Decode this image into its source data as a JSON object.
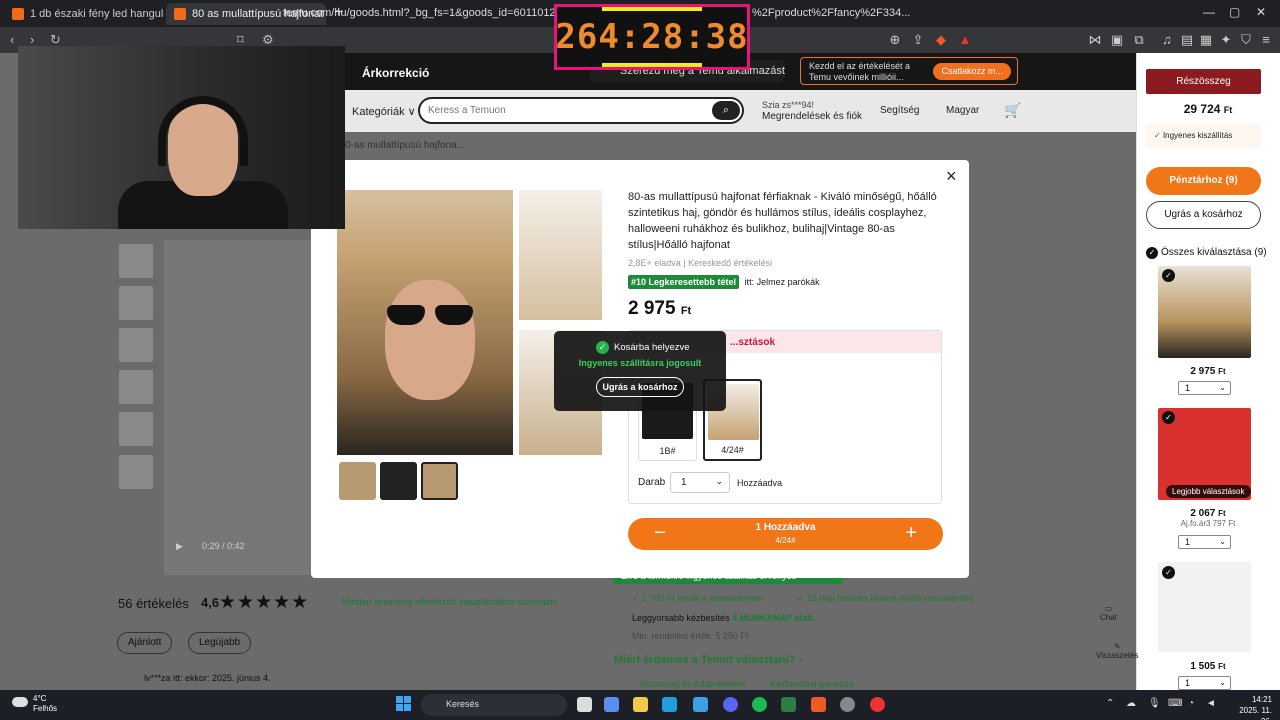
{
  "browser": {
    "tabs": [
      {
        "label": "1 db északi fény led hangulatvetítő lá"
      },
      {
        "label": "80 as mullattípusú hajfonat férfia"
      }
    ],
    "new_tab": "+",
    "url": "temu.com/hu/goods.html?_bg_fs=1&goods_id=601101252687626",
    "url_tail": "%2Fproduct%2Ffancy%2F334..."
  },
  "timer": {
    "value": "264:28:38"
  },
  "temu_header": {
    "arkorrekcio": "Árkorrekció",
    "promo": "Szerezd meg a Temu alkalmazást",
    "review_promo_line1": "Kezdd el az értékelését a",
    "review_promo_line2": "Temu vevőinek millióii...",
    "review_promo_btn": "Csatlakozz m..."
  },
  "search": {
    "categories": "Kategóriák ∨",
    "placeholder": "Keress a Temuon",
    "account_line1": "Szia zs***94!",
    "account_line2": "Megrendelések és fiók",
    "help": "Segítség",
    "lang": "Magyar"
  },
  "breadcrumb": "0-as mullattípusú hajfona...",
  "modal": {
    "title": "80-as mullattípusú hajfonat férfiaknak - Kiváló minőségű, hőálló szintetikus haj, göndör és hullámos stílus, ideális cosplayhez, halloweeni ruhákhoz és bulikhoz, bulihaj|Vintage 80-as stílus|Hőálló hajfonat",
    "sold": "2,8E+ eladva",
    "merchant_rating": "Kereskedő értékelési",
    "rank_badge": "#10 Legkeresettebb tétel",
    "rank_text": "itt: Jelmez parókák",
    "price": "2 975",
    "currency": "Ft",
    "options_header": "...sztások",
    "variants": [
      {
        "label": "1B#"
      },
      {
        "label": "4/24#"
      }
    ],
    "qty_label": "Darab",
    "qty_value": "1",
    "added_label": "Hozzáadva",
    "add_button": "1 Hozzáadva",
    "add_sub": "4/24#",
    "minus": "−",
    "plus": "+",
    "close": "×"
  },
  "toast": {
    "title": "Kosárba helyezve",
    "shipping": "Ingyenes szállításra jogosult",
    "button": "Ugrás a kosárhoz"
  },
  "reviews": {
    "count_label": "56 értékelés",
    "rating": "4,6",
    "stars": "★★★★★",
    "verified": "Minden vélemény ellenőrzött vásárlásokból származik",
    "sort_recommended": "Ajánlott",
    "sort_latest": "Legújabb",
    "reviewer": "lv***za itt:  ekkor: 2025. június 4."
  },
  "video": {
    "time": "0:29 / 0:42"
  },
  "shipping_info": {
    "strip": "Erre a termékre ingyenes szállítás érvényes",
    "credit1": "✓ 1 700 Ft kredit a késedelemért",
    "credit2": "✓ 15 nap frissítés hiánya miatti visszatérítés",
    "fastest_prefix": "Leggyorsabb kézbesítés",
    "fastest_value": "4 MUNKANAP alatt.",
    "min_order": "Min. rendelési érték: 5 250 Ft",
    "why_temu": "Miért érdemes a Temut választani? ›",
    "safety1": "Biztonság és Adatvédelem",
    "safety2": "Kézbesítési garancia"
  },
  "cart_sidebar": {
    "subtotal_btn": "Részösszeg",
    "subtotal": "29 724",
    "currency": "Ft",
    "free_ship_check": "✓",
    "free_ship": "Ingyenes kiszállítás",
    "checkout": "Pénztárhoz (9)",
    "go_cart": "Ugrás a kosárhoz",
    "select_all": "Összes kiválasztása (9)",
    "items": [
      {
        "price": "2 975",
        "qty": "1"
      },
      {
        "price": "2 067",
        "qty": "1",
        "badge": "Legjobb választások",
        "sub": "Aj.fo.ár3 797 Ft"
      },
      {
        "price": "1 505",
        "qty": "1"
      }
    ],
    "chat": "Chat",
    "visits": "Viszaszetés"
  },
  "taskbar": {
    "temp": "4°C",
    "weather": "Felhős",
    "search": "Keresés",
    "time": "14:21",
    "date": "2025. 11. 26."
  }
}
